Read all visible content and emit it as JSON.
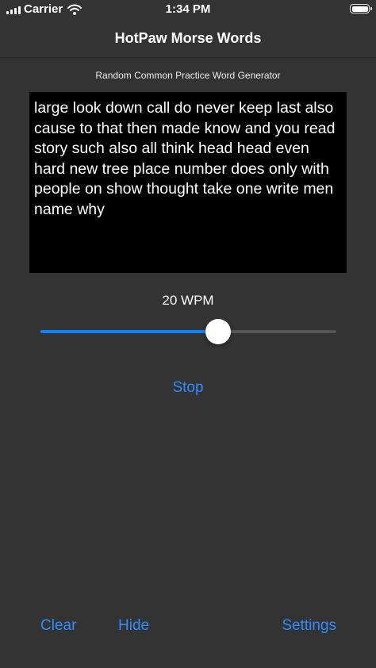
{
  "status_bar": {
    "carrier": "Carrier",
    "time": "1:34 PM"
  },
  "nav": {
    "title": "HotPaw Morse Words"
  },
  "subtitle": "Random Common Practice Word Generator",
  "words_text": "large look down call do never keep last also cause to that then made know and you read story such also all think head head even hard new tree place number does only with people on show thought take one write men name why",
  "speed": {
    "label": "20 WPM",
    "slider_fraction": 0.6
  },
  "buttons": {
    "stop": "Stop",
    "clear": "Clear",
    "hide": "Hide",
    "settings": "Settings"
  },
  "colors": {
    "background": "#333333",
    "accent": "#2f8bff",
    "text_box": "#000000"
  }
}
